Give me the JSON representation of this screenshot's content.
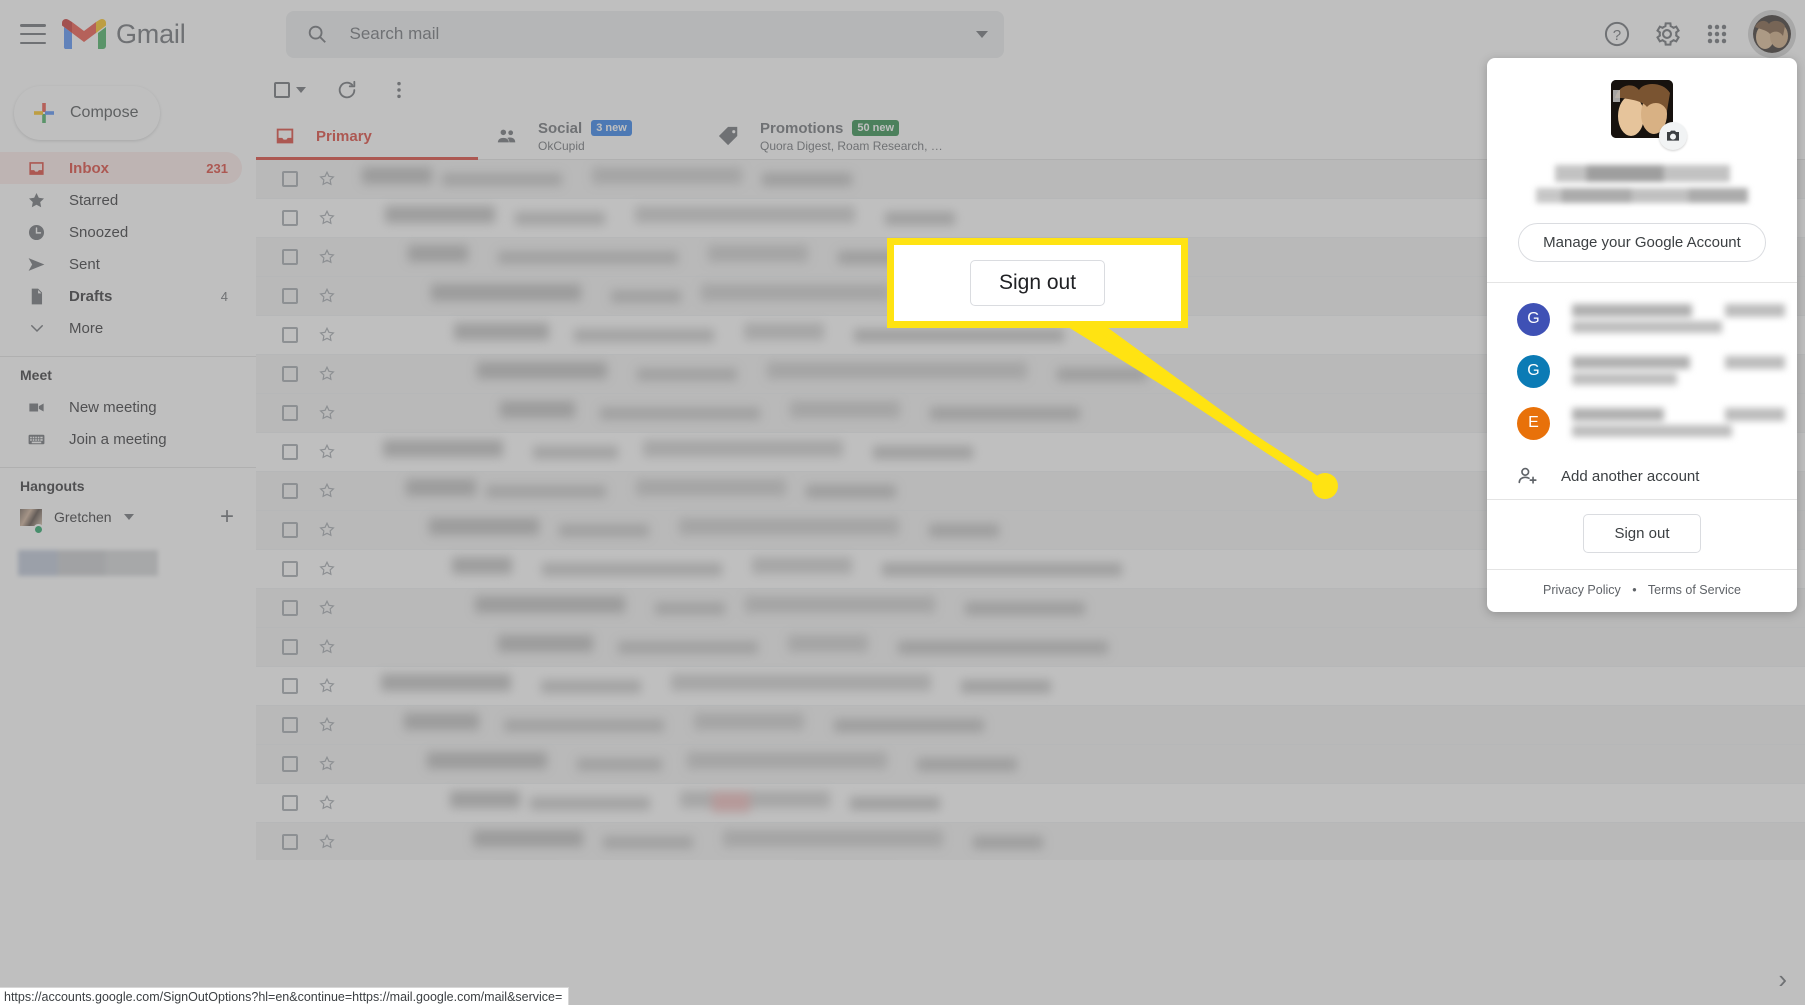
{
  "header": {
    "menu_icon": "hamburger-icon",
    "brand": "Gmail",
    "search": {
      "placeholder": "Search mail",
      "value": "",
      "icon": "search-icon",
      "options_icon": "chevron-down-icon"
    },
    "right_icons": [
      "help-icon",
      "gear-icon",
      "apps-grid-icon",
      "avatar"
    ]
  },
  "sidebar": {
    "compose_label": "Compose",
    "items": [
      {
        "label": "Inbox",
        "count": "231",
        "icon": "inbox-icon",
        "active": true,
        "bold": true
      },
      {
        "label": "Starred",
        "count": "",
        "icon": "star-icon",
        "active": false,
        "bold": false
      },
      {
        "label": "Snoozed",
        "count": "",
        "icon": "clock-icon",
        "active": false,
        "bold": false
      },
      {
        "label": "Sent",
        "count": "",
        "icon": "send-icon",
        "active": false,
        "bold": false
      },
      {
        "label": "Drafts",
        "count": "4",
        "icon": "draft-icon",
        "active": false,
        "bold": true
      },
      {
        "label": "More",
        "count": "",
        "icon": "chevron-down-icon",
        "active": false,
        "bold": false
      }
    ],
    "meet": {
      "title": "Meet",
      "items": [
        {
          "label": "New meeting",
          "icon": "video-camera-icon"
        },
        {
          "label": "Join a meeting",
          "icon": "keyboard-icon"
        }
      ]
    },
    "hangouts": {
      "title": "Hangouts",
      "user": "Gretchen",
      "status": "online",
      "status_color": "#0f9d58",
      "add_icon": "plus-icon",
      "caret_icon": "chevron-down-icon"
    }
  },
  "toolbar": {
    "select_all_icon": "checkbox-icon",
    "select_caret_icon": "chevron-down-icon",
    "refresh_icon": "refresh-icon",
    "more_icon": "more-vertical-icon"
  },
  "tabs": [
    {
      "name": "Primary",
      "icon": "inbox-icon",
      "badge": "",
      "badge_color": "",
      "sub": "",
      "active": true
    },
    {
      "name": "Social",
      "icon": "people-icon",
      "badge": "3 new",
      "badge_color": "#1a73e8",
      "sub": "OkCupid",
      "active": false
    },
    {
      "name": "Promotions",
      "icon": "tag-icon",
      "badge": "50 new",
      "badge_color": "#188038",
      "sub": "Quora Digest, Roam Research, …",
      "active": false
    }
  ],
  "callout": {
    "label": "Sign out",
    "border_color": "#ffe312",
    "pointer_color": "#ffe312"
  },
  "account_panel": {
    "avatar_alt": "user-photo",
    "camera_icon": "camera-icon",
    "manage_label": "Manage your Google Account",
    "accounts": [
      {
        "initial": "G",
        "color": "#3f51b5"
      },
      {
        "initial": "G",
        "color": "#0b7bb5"
      },
      {
        "initial": "E",
        "color": "#e8710a"
      }
    ],
    "add_account_label": "Add another account",
    "add_account_icon": "person-add-icon",
    "signout_label": "Sign out",
    "footer": {
      "privacy": "Privacy Policy",
      "separator": "•",
      "terms": "Terms of Service"
    }
  },
  "statusbar": {
    "url": "https://accounts.google.com/SignOutOptions?hl=en&continue=https://mail.google.com/mail&service="
  },
  "pager": {
    "next_icon": "chevron-right-icon"
  }
}
